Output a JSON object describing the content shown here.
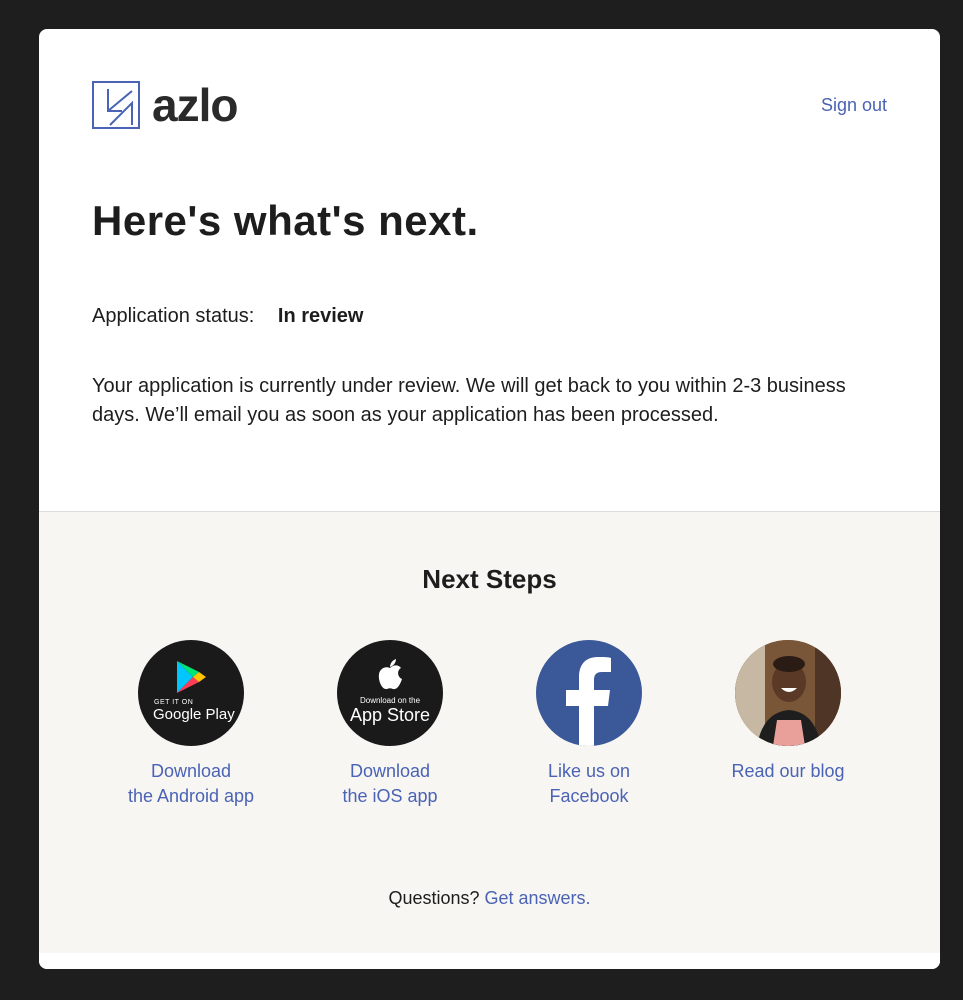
{
  "brand": {
    "name": "azlo",
    "accent": "#4a63b4"
  },
  "header": {
    "signout_label": "Sign out"
  },
  "main": {
    "title": "Here's what's next.",
    "status_label": "Application status:",
    "status_value": "In review",
    "description": "Your application is currently under review. We will get back to you within 2-3 business days. We’ll email you as soon as your application has been processed."
  },
  "next_steps": {
    "title": "Next Steps",
    "items": [
      {
        "icon": "google-play-badge-icon",
        "badge_small": "GET IT ON",
        "badge_big": "Google Play",
        "label_line1": "Download",
        "label_line2": "the Android app"
      },
      {
        "icon": "app-store-badge-icon",
        "badge_small": "Download on the",
        "badge_big": "App Store",
        "label_line1": "Download",
        "label_line2": "the iOS app"
      },
      {
        "icon": "facebook-icon",
        "label_line1": "Like us on",
        "label_line2": "Facebook"
      },
      {
        "icon": "blog-photo",
        "label_line1": "Read our blog",
        "label_line2": ""
      }
    ]
  },
  "footer": {
    "questions_text": "Questions?",
    "answers_link": "Get answers."
  }
}
